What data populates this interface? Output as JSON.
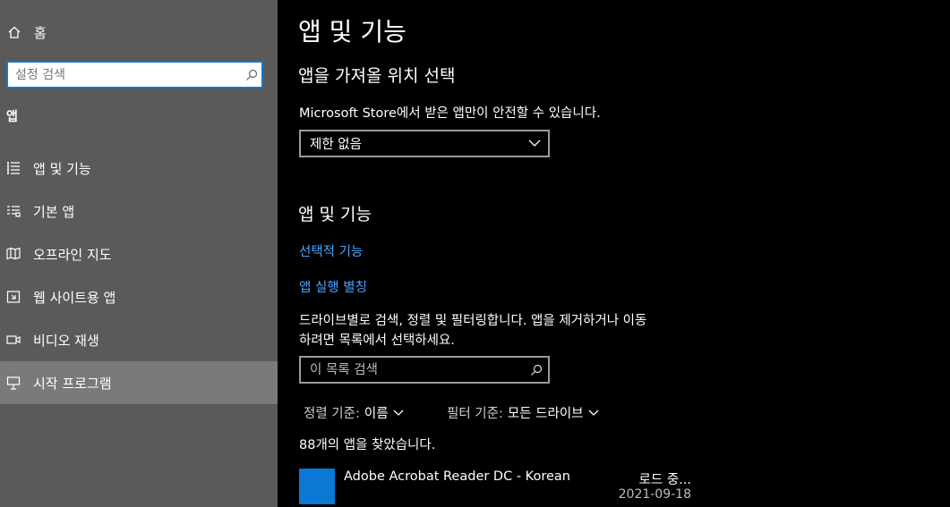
{
  "sidebar": {
    "home_label": "홈",
    "search_placeholder": "설정 검색",
    "section_label": "앱",
    "items": [
      {
        "label": "앱 및 기능",
        "icon": "apps-list-icon"
      },
      {
        "label": "기본 앱",
        "icon": "default-apps-icon"
      },
      {
        "label": "오프라인 지도",
        "icon": "offline-map-icon"
      },
      {
        "label": "웹 사이트용 앱",
        "icon": "web-apps-icon"
      },
      {
        "label": "비디오 재생",
        "icon": "video-icon"
      },
      {
        "label": "시작 프로그램",
        "icon": "startup-icon"
      }
    ],
    "active_index": 5
  },
  "main": {
    "title": "앱 및 기능",
    "install_heading": "앱을 가져올 위치 선택",
    "install_desc": "Microsoft Store에서 받은 앱만이 안전할 수 있습니다.",
    "install_select_value": "제한 없음",
    "apps_heading": "앱 및 기능",
    "link_optional": "선택적 기능",
    "link_alias": "앱 실행 별칭",
    "search_desc_line1": "드라이브별로 검색, 정렬 및 필터링합니다. 앱을 제거하거나 이동",
    "search_desc_line2": "하려면 목록에서 선택하세요.",
    "list_search_placeholder": "이 목록 검색",
    "sort_key": "정렬 기준:",
    "sort_value": "이름",
    "filter_key": "필터 기준:",
    "filter_value": "모든 드라이브",
    "count_text": "88개의 앱을 찾았습니다.",
    "apps": [
      {
        "name": "Adobe Acrobat Reader DC - Korean",
        "size": "로드 중...",
        "date": "2021-09-18",
        "icon_color": "#0a78d4"
      }
    ]
  },
  "colors": {
    "sidebar_bg": "#5a5a5a",
    "sidebar_active": "#7a7a7a",
    "link": "#4aa3ff",
    "accent": "#1a78c2"
  }
}
